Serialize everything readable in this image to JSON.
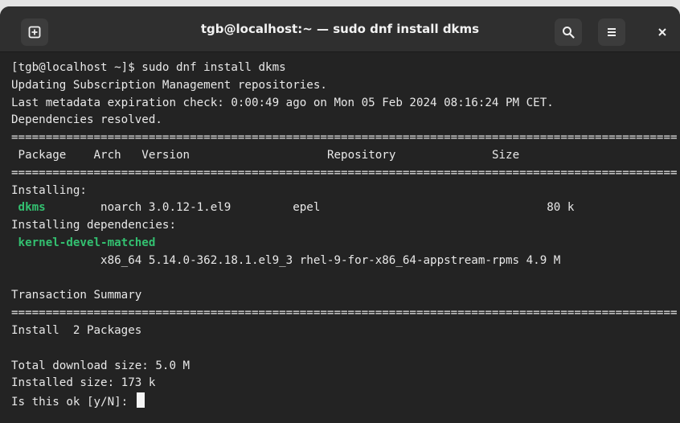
{
  "window": {
    "title": "tgb@localhost:~ — sudo dnf install dkms",
    "icons": [
      "new-tab-icon",
      "search-icon",
      "hamburger-menu-icon",
      "close-icon"
    ]
  },
  "terminal": {
    "prompt": "[tgb@localhost ~]$ sudo dnf install dkms",
    "updating": "Updating Subscription Management repositories.",
    "metadata": "Last metadata expiration check: 0:00:49 ago on Mon 05 Feb 2024 08:16:24 PM CET.",
    "resolved": "Dependencies resolved.",
    "separator": "=================================================================================================",
    "header": {
      "package": " Package",
      "arch": "    Arch",
      "version": "   Version",
      "repository": "                    Repository",
      "size": "              Size"
    },
    "installing_label": "Installing:",
    "pkg1": {
      "name": " dkms",
      "rest": "        noarch 3.0.12-1.el9         epel                                 80 k"
    },
    "deps_label": "Installing dependencies:",
    "pkg2": {
      "name": " kernel-devel-matched",
      "rest": "             x86_64 5.14.0-362.18.1.el9_3 rhel-9-for-x86_64-appstream-rpms 4.9 M"
    },
    "summary_label": "Transaction Summary",
    "install_count": "Install  2 Packages",
    "download_size": "Total download size: 5.0 M",
    "installed_size": "Installed size: 173 k",
    "confirm_prompt": "Is this ok [y/N]: "
  },
  "colors": {
    "package_highlight": "#33c070",
    "background": "#232323",
    "text": "#e8e8e8"
  }
}
